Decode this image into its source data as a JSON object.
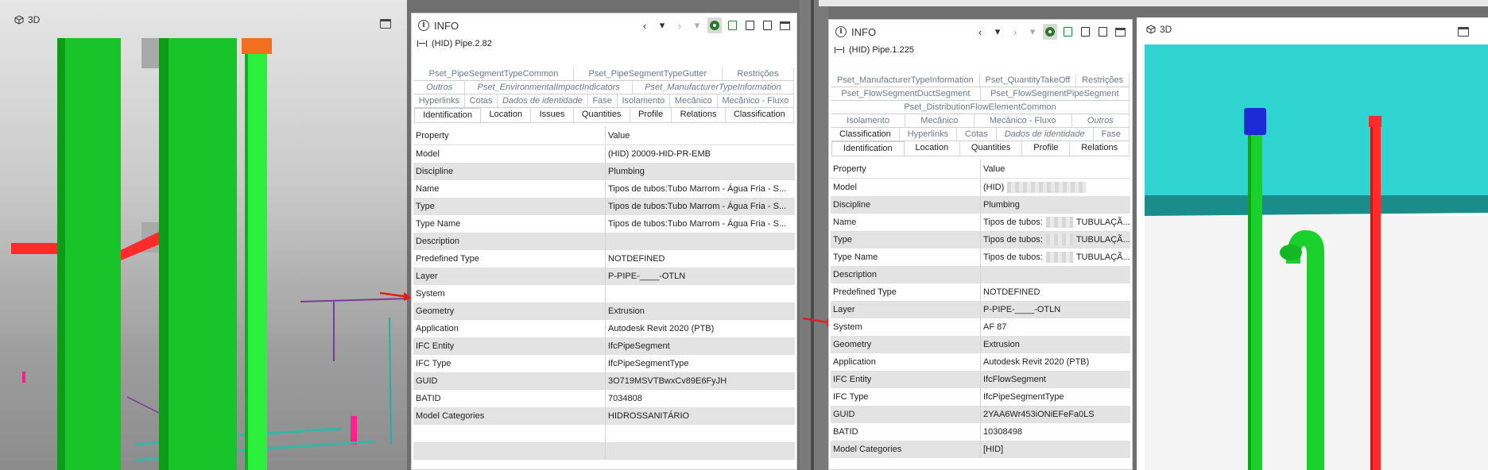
{
  "left": {
    "viewport": {
      "label": "3D",
      "icons": [
        "cube-icon",
        "window-icon"
      ]
    },
    "info": {
      "title": "INFO",
      "element": "(HID) Pipe.2.82",
      "tab_rows": [
        [
          {
            "label": "Pset_PipeSegmentTypeCommon",
            "italic": false
          },
          {
            "label": "Pset_PipeSegmentTypeGutter",
            "italic": false
          },
          {
            "label": "Restrições",
            "italic": false
          }
        ],
        [
          {
            "label": "Outros",
            "italic": true
          },
          {
            "label": "Pset_EnvironmentalImpactIndicators",
            "italic": true
          },
          {
            "label": "Pset_ManufacturerTypeInformation",
            "italic": true
          }
        ],
        [
          {
            "label": "Hyperlinks",
            "italic": false
          },
          {
            "label": "Cotas",
            "italic": false
          },
          {
            "label": "Dados de identidade",
            "italic": true
          },
          {
            "label": "Fase",
            "italic": false
          },
          {
            "label": "Isolamento",
            "italic": false
          },
          {
            "label": "Mecânico",
            "italic": false
          },
          {
            "label": "Mecânico - Fluxo",
            "italic": false
          }
        ]
      ],
      "main_tabs": [
        "Identification",
        "Location",
        "Issues",
        "Quantities",
        "Profile",
        "Relations",
        "Classification"
      ],
      "selected_tab": "Identification",
      "columns": [
        "Property",
        "Value"
      ],
      "rows": [
        {
          "property": "Model",
          "value": "(HID) 20009-HID-PR-EMB"
        },
        {
          "property": "Discipline",
          "value": "Plumbing"
        },
        {
          "property": "Name",
          "value": "Tipos de tubos:Tubo Marrom - Água Fria - S..."
        },
        {
          "property": "Type",
          "value": "Tipos de tubos:Tubo Marrom - Água Fria - S..."
        },
        {
          "property": "Type Name",
          "value": "Tipos de tubos:Tubo Marrom - Água Fria - S..."
        },
        {
          "property": "Description",
          "value": ""
        },
        {
          "property": "Predefined Type",
          "value": "NOTDEFINED"
        },
        {
          "property": "Layer",
          "value": "P-PIPE-____-OTLN"
        },
        {
          "property": "System",
          "value": ""
        },
        {
          "property": "Geometry",
          "value": "Extrusion"
        },
        {
          "property": "Application",
          "value": "Autodesk Revit 2020 (PTB)"
        },
        {
          "property": "IFC Entity",
          "value": "IfcPipeSegment"
        },
        {
          "property": "IFC Type",
          "value": "IfcPipeSegmentType"
        },
        {
          "property": "GUID",
          "value": "3O719MSVTBwxCv89E6FyJH"
        },
        {
          "property": "BATID",
          "value": "7034808"
        },
        {
          "property": "Model Categories",
          "value": "HIDROSSANITÁRIO"
        }
      ]
    }
  },
  "right": {
    "viewport": {
      "label": "3D",
      "icons": [
        "cube-icon",
        "window-icon"
      ]
    },
    "info": {
      "title": "INFO",
      "element": "(HID) Pipe.1.225",
      "tab_rows": [
        [
          {
            "label": "Pset_ManufacturerTypeInformation",
            "italic": false
          },
          {
            "label": "Pset_QuantityTakeOff",
            "italic": false
          },
          {
            "label": "Restrições",
            "italic": false
          }
        ],
        [
          {
            "label": "Pset_FlowSegmentDuctSegment",
            "italic": false
          },
          {
            "label": "Pset_FlowSegmentPipeSegment",
            "italic": false
          }
        ],
        [
          {
            "label": "Pset_DistributionFlowElementCommon",
            "italic": false
          }
        ],
        [
          {
            "label": "Isolamento",
            "italic": false
          },
          {
            "label": "Mecânico",
            "italic": false
          },
          {
            "label": "Mecânico - Fluxo",
            "italic": false
          },
          {
            "label": "Outros",
            "italic": true
          }
        ],
        [
          {
            "label": "Classification",
            "italic": false
          },
          {
            "label": "Hyperlinks",
            "italic": false
          },
          {
            "label": "Cotas",
            "italic": false
          },
          {
            "label": "Dados de identidade",
            "italic": true
          },
          {
            "label": "Fase",
            "italic": false
          }
        ]
      ],
      "main_tabs": [
        "Identification",
        "Location",
        "Quantities",
        "Profile",
        "Relations"
      ],
      "selected_tab": "Identification",
      "columns": [
        "Property",
        "Value"
      ],
      "rows": [
        {
          "property": "Model",
          "value": "(HID)",
          "blur": "wide"
        },
        {
          "property": "Discipline",
          "value": "Plumbing"
        },
        {
          "property": "Name",
          "value": "Tipos de tubos:",
          "blur": "mid",
          "suffix": "TUBULAÇÃ..."
        },
        {
          "property": "Type",
          "value": "Tipos de tubos:",
          "blur": "mid",
          "suffix": "TUBULAÇÃ..."
        },
        {
          "property": "Type Name",
          "value": "Tipos de tubos:",
          "blur": "mid",
          "suffix": "TUBULAÇÃ..."
        },
        {
          "property": "Description",
          "value": ""
        },
        {
          "property": "Predefined Type",
          "value": "NOTDEFINED"
        },
        {
          "property": "Layer",
          "value": "P-PIPE-____-OTLN"
        },
        {
          "property": "System",
          "value": "AF 87"
        },
        {
          "property": "Geometry",
          "value": "Extrusion"
        },
        {
          "property": "Application",
          "value": "Autodesk Revit 2020 (PTB)"
        },
        {
          "property": "IFC Entity",
          "value": "IfcFlowSegment"
        },
        {
          "property": "IFC Type",
          "value": "IfcPipeSegmentType"
        },
        {
          "property": "GUID",
          "value": "2YAA6Wr453iONiEFeFa0LS"
        },
        {
          "property": "BATID",
          "value": "10308498"
        },
        {
          "property": "Model Categories",
          "value": "[HID]"
        }
      ]
    }
  },
  "colors": {
    "pipe_green": "#19d12a",
    "pipe_red": "#ff2a2a",
    "pipe_blue": "#1d2bd6",
    "sky_cyan": "#2fd3d0",
    "arrow_red": "#e02020"
  }
}
